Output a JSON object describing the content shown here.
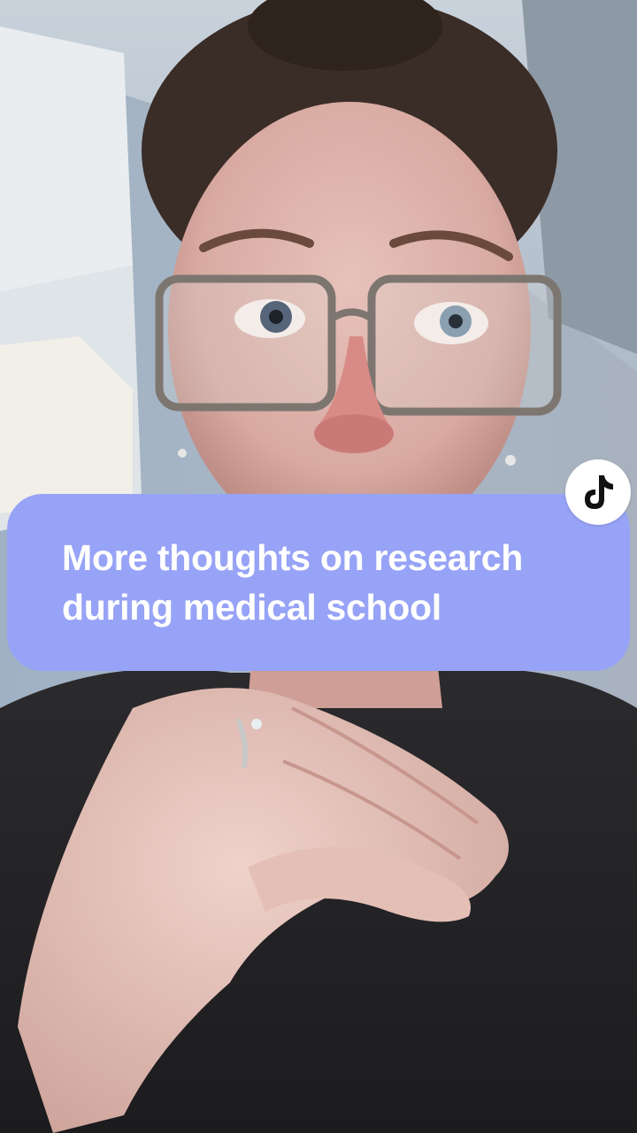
{
  "caption": {
    "text": "More thoughts on research\nduring medical school",
    "background_color": "#97a3f6",
    "text_color": "#ffffff"
  },
  "badge": {
    "icon": "tiktok-logo-icon"
  },
  "background": {
    "description_icon": "video-frame"
  }
}
